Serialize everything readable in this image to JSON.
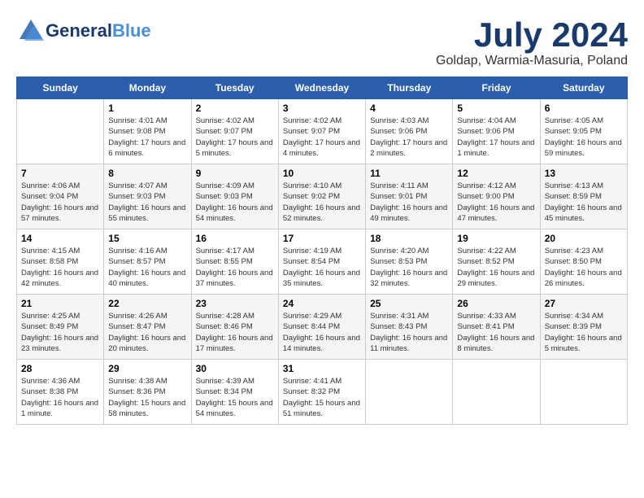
{
  "header": {
    "logo_general": "General",
    "logo_blue": "Blue",
    "month_title": "July 2024",
    "location": "Goldap, Warmia-Masuria, Poland"
  },
  "days_of_week": [
    "Sunday",
    "Monday",
    "Tuesday",
    "Wednesday",
    "Thursday",
    "Friday",
    "Saturday"
  ],
  "weeks": [
    [
      {
        "day": "",
        "info": ""
      },
      {
        "day": "1",
        "sunrise": "Sunrise: 4:01 AM",
        "sunset": "Sunset: 9:08 PM",
        "daylight": "Daylight: 17 hours and 6 minutes."
      },
      {
        "day": "2",
        "sunrise": "Sunrise: 4:02 AM",
        "sunset": "Sunset: 9:07 PM",
        "daylight": "Daylight: 17 hours and 5 minutes."
      },
      {
        "day": "3",
        "sunrise": "Sunrise: 4:02 AM",
        "sunset": "Sunset: 9:07 PM",
        "daylight": "Daylight: 17 hours and 4 minutes."
      },
      {
        "day": "4",
        "sunrise": "Sunrise: 4:03 AM",
        "sunset": "Sunset: 9:06 PM",
        "daylight": "Daylight: 17 hours and 2 minutes."
      },
      {
        "day": "5",
        "sunrise": "Sunrise: 4:04 AM",
        "sunset": "Sunset: 9:06 PM",
        "daylight": "Daylight: 17 hours and 1 minute."
      },
      {
        "day": "6",
        "sunrise": "Sunrise: 4:05 AM",
        "sunset": "Sunset: 9:05 PM",
        "daylight": "Daylight: 16 hours and 59 minutes."
      }
    ],
    [
      {
        "day": "7",
        "sunrise": "Sunrise: 4:06 AM",
        "sunset": "Sunset: 9:04 PM",
        "daylight": "Daylight: 16 hours and 57 minutes."
      },
      {
        "day": "8",
        "sunrise": "Sunrise: 4:07 AM",
        "sunset": "Sunset: 9:03 PM",
        "daylight": "Daylight: 16 hours and 55 minutes."
      },
      {
        "day": "9",
        "sunrise": "Sunrise: 4:09 AM",
        "sunset": "Sunset: 9:03 PM",
        "daylight": "Daylight: 16 hours and 54 minutes."
      },
      {
        "day": "10",
        "sunrise": "Sunrise: 4:10 AM",
        "sunset": "Sunset: 9:02 PM",
        "daylight": "Daylight: 16 hours and 52 minutes."
      },
      {
        "day": "11",
        "sunrise": "Sunrise: 4:11 AM",
        "sunset": "Sunset: 9:01 PM",
        "daylight": "Daylight: 16 hours and 49 minutes."
      },
      {
        "day": "12",
        "sunrise": "Sunrise: 4:12 AM",
        "sunset": "Sunset: 9:00 PM",
        "daylight": "Daylight: 16 hours and 47 minutes."
      },
      {
        "day": "13",
        "sunrise": "Sunrise: 4:13 AM",
        "sunset": "Sunset: 8:59 PM",
        "daylight": "Daylight: 16 hours and 45 minutes."
      }
    ],
    [
      {
        "day": "14",
        "sunrise": "Sunrise: 4:15 AM",
        "sunset": "Sunset: 8:58 PM",
        "daylight": "Daylight: 16 hours and 42 minutes."
      },
      {
        "day": "15",
        "sunrise": "Sunrise: 4:16 AM",
        "sunset": "Sunset: 8:57 PM",
        "daylight": "Daylight: 16 hours and 40 minutes."
      },
      {
        "day": "16",
        "sunrise": "Sunrise: 4:17 AM",
        "sunset": "Sunset: 8:55 PM",
        "daylight": "Daylight: 16 hours and 37 minutes."
      },
      {
        "day": "17",
        "sunrise": "Sunrise: 4:19 AM",
        "sunset": "Sunset: 8:54 PM",
        "daylight": "Daylight: 16 hours and 35 minutes."
      },
      {
        "day": "18",
        "sunrise": "Sunrise: 4:20 AM",
        "sunset": "Sunset: 8:53 PM",
        "daylight": "Daylight: 16 hours and 32 minutes."
      },
      {
        "day": "19",
        "sunrise": "Sunrise: 4:22 AM",
        "sunset": "Sunset: 8:52 PM",
        "daylight": "Daylight: 16 hours and 29 minutes."
      },
      {
        "day": "20",
        "sunrise": "Sunrise: 4:23 AM",
        "sunset": "Sunset: 8:50 PM",
        "daylight": "Daylight: 16 hours and 26 minutes."
      }
    ],
    [
      {
        "day": "21",
        "sunrise": "Sunrise: 4:25 AM",
        "sunset": "Sunset: 8:49 PM",
        "daylight": "Daylight: 16 hours and 23 minutes."
      },
      {
        "day": "22",
        "sunrise": "Sunrise: 4:26 AM",
        "sunset": "Sunset: 8:47 PM",
        "daylight": "Daylight: 16 hours and 20 minutes."
      },
      {
        "day": "23",
        "sunrise": "Sunrise: 4:28 AM",
        "sunset": "Sunset: 8:46 PM",
        "daylight": "Daylight: 16 hours and 17 minutes."
      },
      {
        "day": "24",
        "sunrise": "Sunrise: 4:29 AM",
        "sunset": "Sunset: 8:44 PM",
        "daylight": "Daylight: 16 hours and 14 minutes."
      },
      {
        "day": "25",
        "sunrise": "Sunrise: 4:31 AM",
        "sunset": "Sunset: 8:43 PM",
        "daylight": "Daylight: 16 hours and 11 minutes."
      },
      {
        "day": "26",
        "sunrise": "Sunrise: 4:33 AM",
        "sunset": "Sunset: 8:41 PM",
        "daylight": "Daylight: 16 hours and 8 minutes."
      },
      {
        "day": "27",
        "sunrise": "Sunrise: 4:34 AM",
        "sunset": "Sunset: 8:39 PM",
        "daylight": "Daylight: 16 hours and 5 minutes."
      }
    ],
    [
      {
        "day": "28",
        "sunrise": "Sunrise: 4:36 AM",
        "sunset": "Sunset: 8:38 PM",
        "daylight": "Daylight: 16 hours and 1 minute."
      },
      {
        "day": "29",
        "sunrise": "Sunrise: 4:38 AM",
        "sunset": "Sunset: 8:36 PM",
        "daylight": "Daylight: 15 hours and 58 minutes."
      },
      {
        "day": "30",
        "sunrise": "Sunrise: 4:39 AM",
        "sunset": "Sunset: 8:34 PM",
        "daylight": "Daylight: 15 hours and 54 minutes."
      },
      {
        "day": "31",
        "sunrise": "Sunrise: 4:41 AM",
        "sunset": "Sunset: 8:32 PM",
        "daylight": "Daylight: 15 hours and 51 minutes."
      },
      {
        "day": "",
        "info": ""
      },
      {
        "day": "",
        "info": ""
      },
      {
        "day": "",
        "info": ""
      }
    ]
  ]
}
